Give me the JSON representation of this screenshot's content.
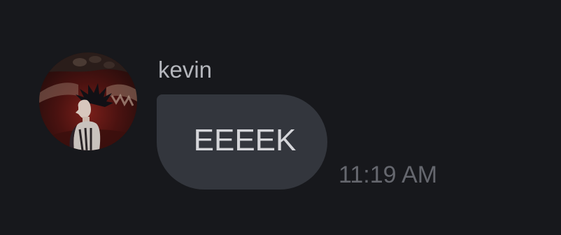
{
  "message": {
    "sender_name": "kevin",
    "text": "EEEEK",
    "timestamp": "11:19 AM",
    "avatar_icon": "user-avatar-photo"
  },
  "colors": {
    "background": "#17181c",
    "bubble": "#33363d",
    "sender_name": "#b4b6bc",
    "message_text": "#d5d6da",
    "timestamp": "#65676e"
  }
}
